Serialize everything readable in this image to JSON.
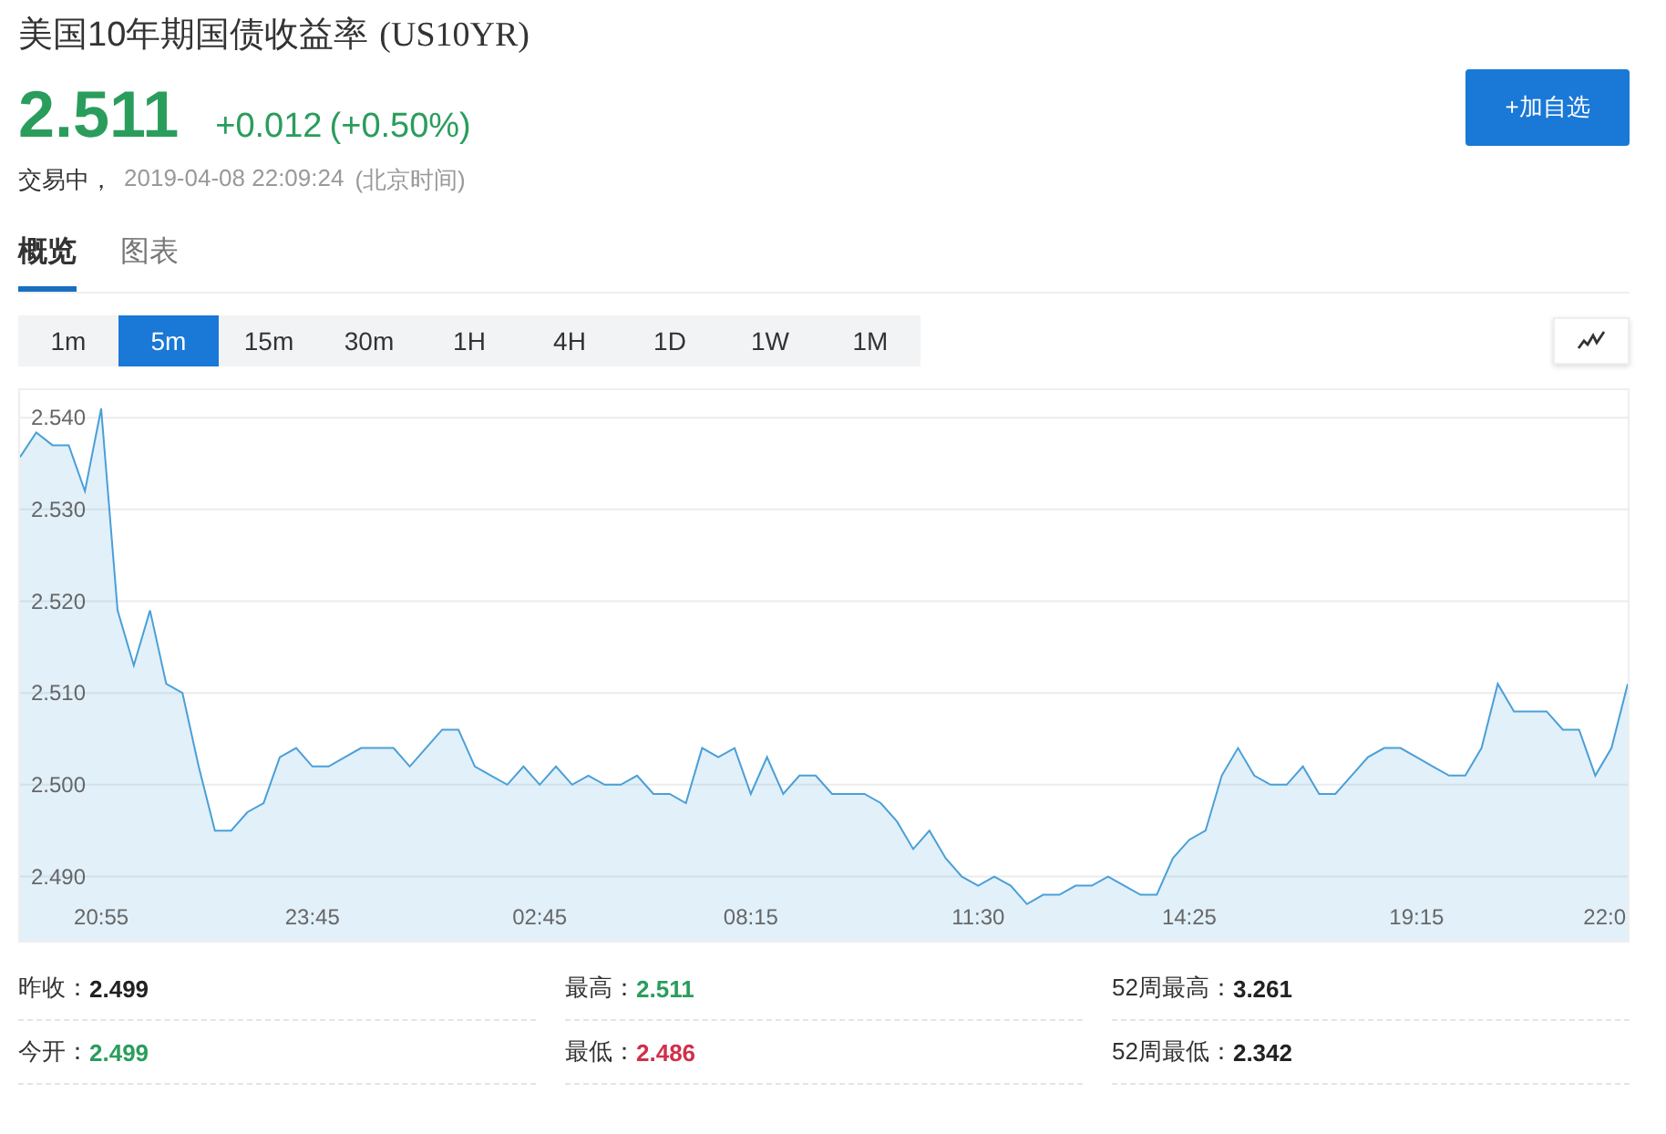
{
  "header": {
    "title": "美国10年期国债收益率",
    "symbol": "(US10YR)",
    "price": "2.511",
    "change": "+0.012",
    "change_pct": "(+0.50%)",
    "status": "交易中，",
    "timestamp": "2019-04-08 22:09:24",
    "timezone": "(北京时间)",
    "watch_button": "+加自选"
  },
  "tabs": [
    {
      "label": "概览",
      "selected": true
    },
    {
      "label": "图表",
      "selected": false
    }
  ],
  "intervals": [
    {
      "label": "1m",
      "selected": false
    },
    {
      "label": "5m",
      "selected": true
    },
    {
      "label": "15m",
      "selected": false
    },
    {
      "label": "30m",
      "selected": false
    },
    {
      "label": "1H",
      "selected": false
    },
    {
      "label": "4H",
      "selected": false
    },
    {
      "label": "1D",
      "selected": false
    },
    {
      "label": "1W",
      "selected": false
    },
    {
      "label": "1M",
      "selected": false
    }
  ],
  "chart": {
    "chart_data": {
      "type": "area",
      "categories": [
        null,
        null,
        null,
        null,
        null,
        "20:55",
        null,
        null,
        null,
        null,
        null,
        null,
        null,
        null,
        null,
        null,
        null,
        null,
        "23:45",
        null,
        null,
        null,
        null,
        null,
        null,
        null,
        null,
        null,
        null,
        null,
        null,
        null,
        "02:45",
        null,
        null,
        null,
        null,
        null,
        null,
        null,
        null,
        null,
        null,
        null,
        null,
        "08:15",
        null,
        null,
        null,
        null,
        null,
        null,
        null,
        null,
        null,
        null,
        null,
        null,
        null,
        "11:30",
        null,
        null,
        null,
        null,
        null,
        null,
        null,
        null,
        null,
        null,
        null,
        null,
        "14:25",
        null,
        null,
        null,
        null,
        null,
        null,
        null,
        null,
        null,
        null,
        null,
        null,
        null,
        "19:15",
        null,
        null,
        null,
        null,
        null,
        null,
        null,
        null,
        null,
        null,
        null,
        "22:0",
        null
      ],
      "series": [
        {
          "color": "#4a9fd8",
          "values": [
            2.5357,
            2.5384,
            2.537,
            2.537,
            2.532,
            2.541,
            2.519,
            2.513,
            2.519,
            2.511,
            2.51,
            2.502,
            2.495,
            2.495,
            2.497,
            2.498,
            2.503,
            2.504,
            2.502,
            2.502,
            2.503,
            2.504,
            2.504,
            2.504,
            2.502,
            2.504,
            2.506,
            2.506,
            2.502,
            2.501,
            2.5,
            2.502,
            2.5,
            2.502,
            2.5,
            2.501,
            2.5,
            2.5,
            2.501,
            2.499,
            2.499,
            2.498,
            2.504,
            2.503,
            2.504,
            2.499,
            2.503,
            2.499,
            2.501,
            2.501,
            2.499,
            2.499,
            2.499,
            2.498,
            2.496,
            2.493,
            2.495,
            2.492,
            2.49,
            2.489,
            2.49,
            2.489,
            2.487,
            2.488,
            2.488,
            2.489,
            2.489,
            2.49,
            2.489,
            2.488,
            2.488,
            2.492,
            2.494,
            2.495,
            2.501,
            2.504,
            2.501,
            2.5,
            2.5,
            2.502,
            2.499,
            2.499,
            2.501,
            2.503,
            2.504,
            2.504,
            2.503,
            2.502,
            2.501,
            2.501,
            2.504,
            2.511,
            2.508,
            2.508,
            2.508,
            2.506,
            2.506,
            2.501,
            2.504,
            2.511
          ]
        }
      ],
      "ylim": [
        2.483,
        2.543
      ],
      "grid": true,
      "yticks": [
        {
          "value": 2.49,
          "label": "2.490"
        },
        {
          "value": 2.5,
          "label": "2.500"
        },
        {
          "value": 2.51,
          "label": "2.510"
        },
        {
          "value": 2.52,
          "label": "2.520"
        },
        {
          "value": 2.53,
          "label": "2.530"
        },
        {
          "value": 2.54,
          "label": "2.540"
        }
      ]
    }
  },
  "stats": [
    [
      {
        "label": "昨收：",
        "value": "2.499",
        "color": "#222222"
      },
      {
        "label": "今开：",
        "value": "2.499",
        "color": "#2a9d5c"
      }
    ],
    [
      {
        "label": "最高：",
        "value": "2.511",
        "color": "#2a9d5c"
      },
      {
        "label": "最低：",
        "value": "2.486",
        "color": "#d0304a"
      }
    ],
    [
      {
        "label": "52周最高：",
        "value": "3.261",
        "color": "#222222"
      },
      {
        "label": "52周最低：",
        "value": "2.342",
        "color": "#222222"
      }
    ]
  ]
}
